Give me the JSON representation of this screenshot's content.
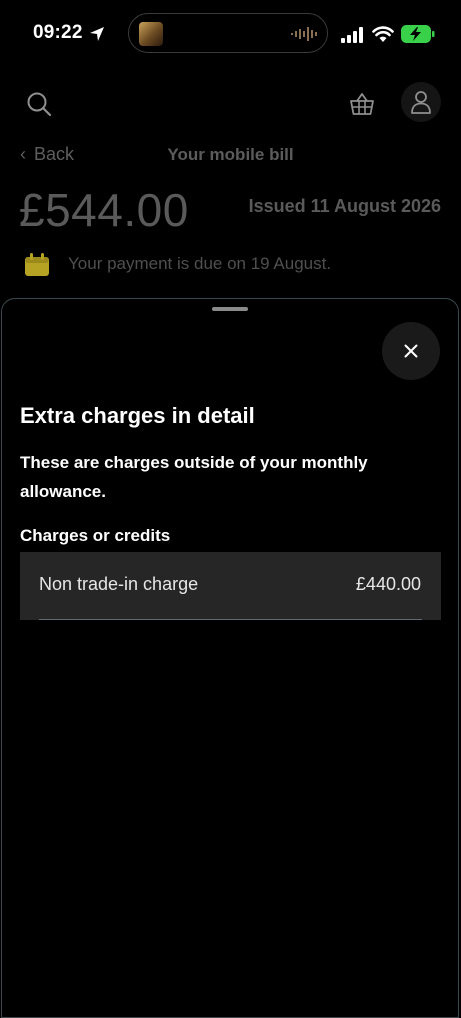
{
  "status_bar": {
    "time": "09:22",
    "battery_state": "charging",
    "colors": {
      "battery": "#3ad14a"
    }
  },
  "header": {
    "icons": [
      "search-icon",
      "basket-icon",
      "account-icon"
    ]
  },
  "nav": {
    "back_label": "Back",
    "title": "Your mobile bill"
  },
  "bill": {
    "amount": "£544.00",
    "issued": "Issued 11 August 2026",
    "due_text": "Your payment is due on 19 August.",
    "colors": {
      "calendar_icon": "#b6a223"
    }
  },
  "sheet": {
    "title": "Extra charges in detail",
    "description": "These are charges outside of your monthly allowance.",
    "section_label": "Charges or credits",
    "charges": [
      {
        "name": "Non trade-in charge",
        "amount": "£440.00"
      }
    ]
  }
}
